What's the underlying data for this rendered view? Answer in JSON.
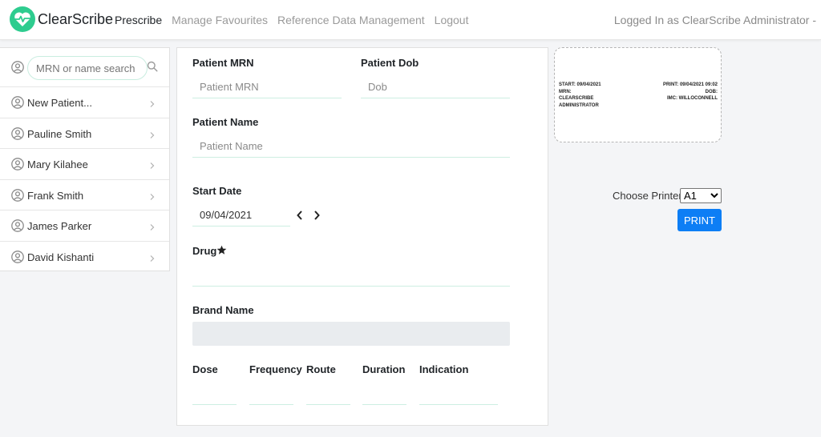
{
  "nav": {
    "brand": "ClearScribe",
    "links": [
      "Prescribe",
      "Manage Favourites",
      "Reference Data Management",
      "Logout"
    ],
    "logged_in": "Logged In as ClearScribe Administrator -"
  },
  "sidebar": {
    "search_placeholder": "MRN or name search",
    "items": [
      {
        "label": "New Patient..."
      },
      {
        "label": "Pauline Smith"
      },
      {
        "label": "Mary Kilahee"
      },
      {
        "label": "Frank Smith"
      },
      {
        "label": "James Parker"
      },
      {
        "label": "David Kishanti"
      }
    ]
  },
  "form": {
    "mrn_label": "Patient MRN",
    "mrn_placeholder": "Patient MRN",
    "dob_label": "Patient Dob",
    "dob_placeholder": "Dob",
    "name_label": "Patient Name",
    "name_placeholder": "Patient Name",
    "start_label": "Start Date",
    "start_value": "09/04/2021",
    "drug_label": "Drug",
    "brand_label": "Brand Name",
    "dose_label": "Dose",
    "frequency_label": "Frequency",
    "route_label": "Route",
    "duration_label": "Duration",
    "indication_label": "Indication"
  },
  "label_preview": {
    "start": "START: 09/04/2021",
    "mrn": "MRN:",
    "name_line1": "CLEARSCRIBE",
    "name_line2": "ADMINISTRATOR",
    "print": "PRINT: 09/04/2021 09:02",
    "dob": "DOB:",
    "imc": "IMC: WILLOCONNELL"
  },
  "printer": {
    "label": "Choose Printer:",
    "selected": "A1",
    "button": "PRINT"
  },
  "colors": {
    "accent": "#2ecc8f",
    "primary_button": "#0d7ef5"
  }
}
